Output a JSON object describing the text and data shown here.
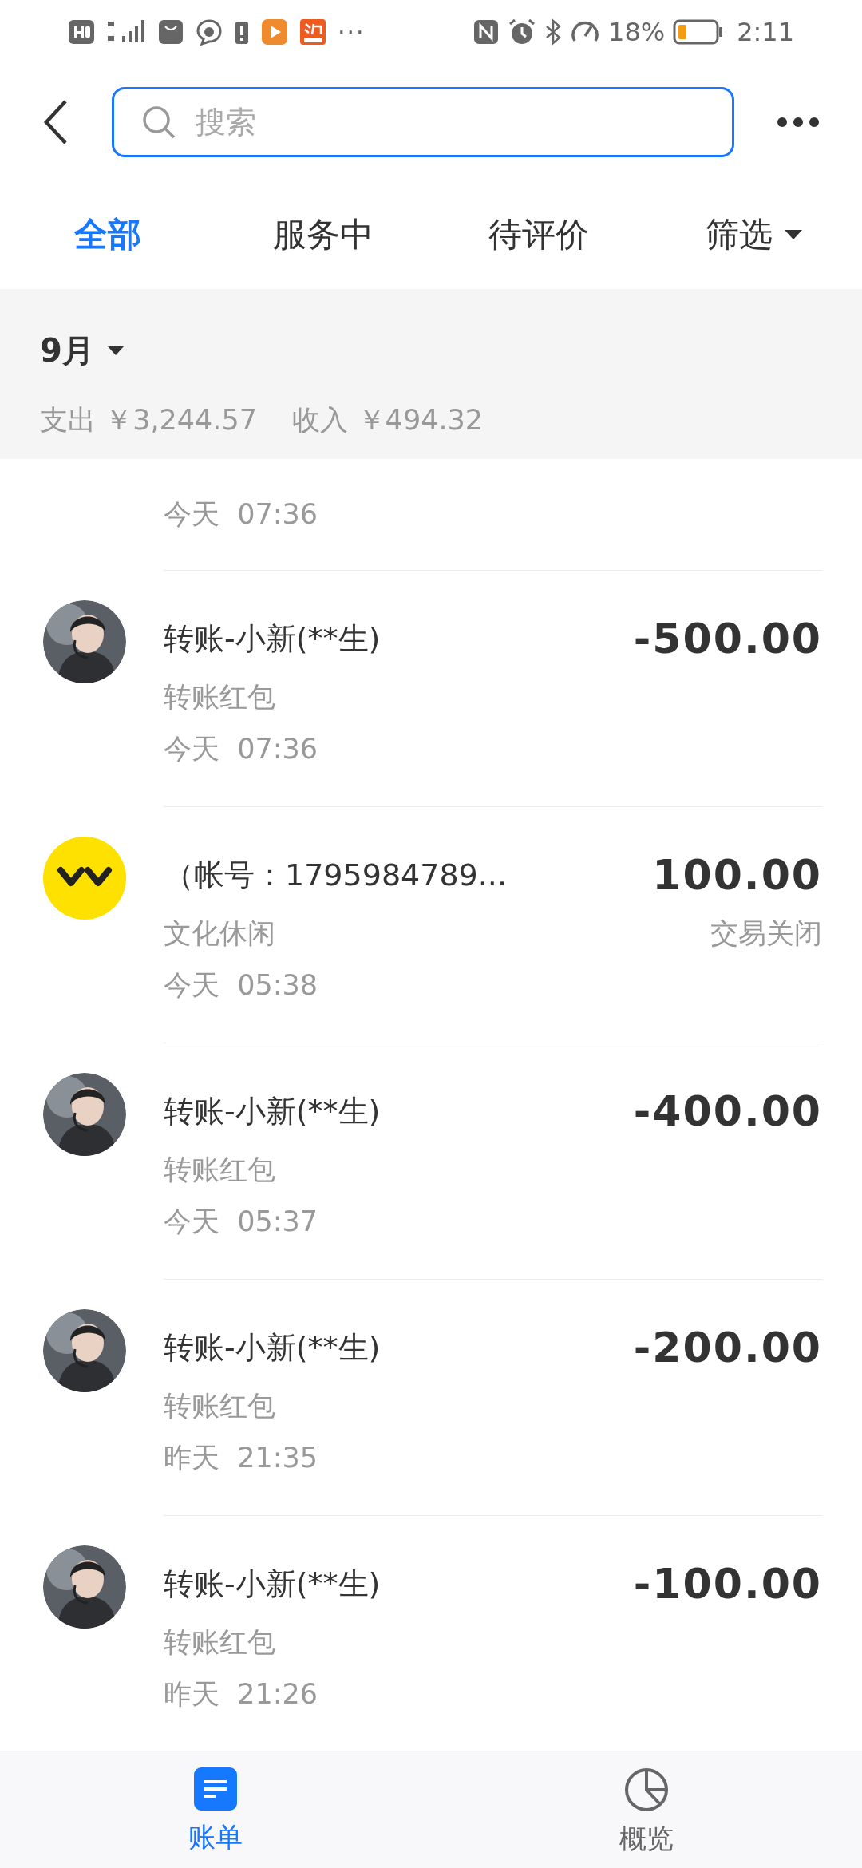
{
  "status_bar": {
    "battery_text": "18%",
    "time": "2:11",
    "more": "···"
  },
  "search": {
    "placeholder": "搜索"
  },
  "tabs": [
    {
      "label": "全部",
      "selected": true,
      "kind": "tab"
    },
    {
      "label": "服务中",
      "selected": false,
      "kind": "tab"
    },
    {
      "label": "待评价",
      "selected": false,
      "kind": "tab"
    },
    {
      "label": "筛选",
      "selected": false,
      "kind": "dropdown"
    }
  ],
  "month_header": {
    "month": "9月",
    "summary": "支出 ￥3,244.57    收入 ￥494.32"
  },
  "transactions": [
    {
      "time": "今天  07:36"
    },
    {
      "kind": "person",
      "title": "转账-小新(**生)",
      "category": "转账红包",
      "time": "今天  07:36",
      "amount": "-500.00"
    },
    {
      "kind": "logo",
      "title": "（帐号：1795984789...",
      "category": "文化休闲",
      "time": "今天  05:38",
      "amount": "100.00",
      "status": "交易关闭"
    },
    {
      "kind": "person",
      "title": "转账-小新(**生)",
      "category": "转账红包",
      "time": "今天  05:37",
      "amount": "-400.00"
    },
    {
      "kind": "person",
      "title": "转账-小新(**生)",
      "category": "转账红包",
      "time": "昨天  21:35",
      "amount": "-200.00"
    },
    {
      "kind": "person",
      "title": "转账-小新(**生)",
      "category": "转账红包",
      "time": "昨天  21:26",
      "amount": "-100.00"
    }
  ],
  "bottom_nav": [
    {
      "label": "账单",
      "selected": true,
      "kind": "bill"
    },
    {
      "label": "概览",
      "selected": false,
      "kind": "overview"
    }
  ]
}
